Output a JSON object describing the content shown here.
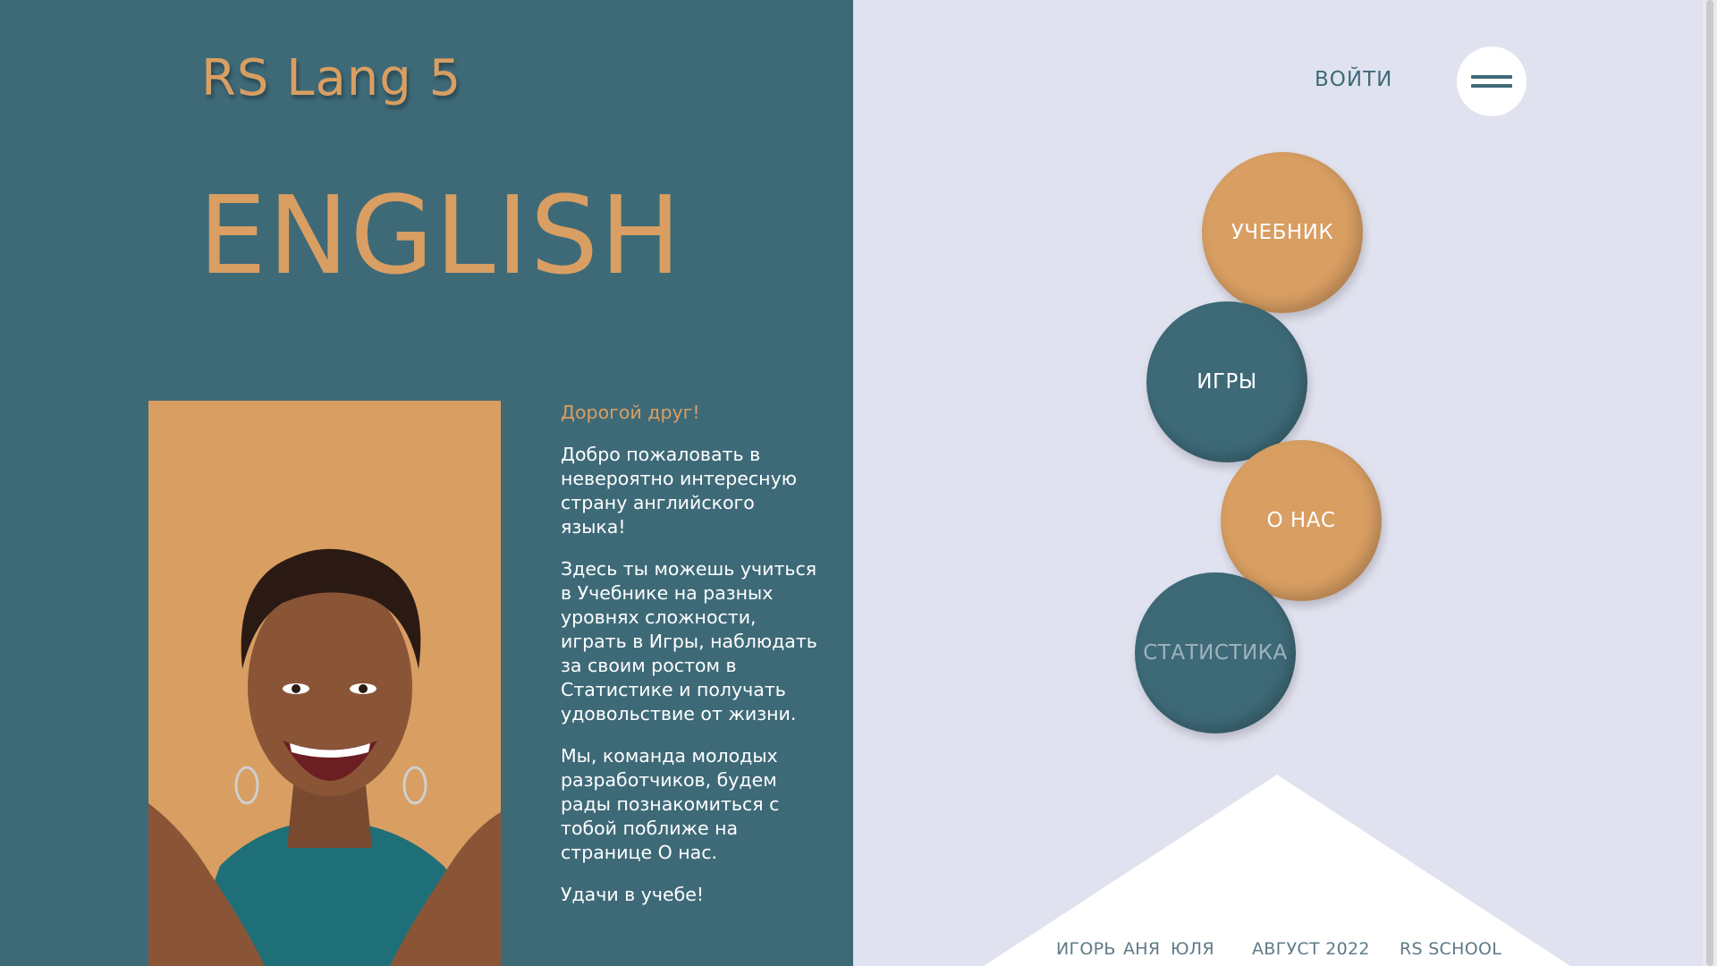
{
  "header": {
    "logo": "RS Lang 5",
    "login_label": "ВОЙТИ",
    "menu_icon": "hamburger-icon"
  },
  "hero": {
    "title": "ENGLISH",
    "photo_alt_icon": "smiling-woman-photo"
  },
  "welcome": {
    "greeting": "Дорогой друг!",
    "paragraphs": [
      "Добро пожаловать в невероятно интересную страну английского языка!",
      "Здесь ты можешь учиться в Учебнике на разных уровнях сложности, играть в Игры, наблюдать за своим ростом в Статистике и получать удовольствие от жизни.",
      "Мы, команда молодых разработчиков, будем рады познакомиться с тобой поближе на странице О нас.",
      "Удачи в учебе!"
    ]
  },
  "nav": {
    "textbook": "УЧЕБНИК",
    "games": "ИГРЫ",
    "about": "О НАС",
    "statistics": "СТАТИСТИКА"
  },
  "footer": {
    "authors": [
      "ИГОРЬ",
      "АНЯ",
      "ЮЛЯ"
    ],
    "date": "АВГУСТ 2022",
    "school": "RS SCHOOL"
  },
  "colors": {
    "teal": "#3e6a78",
    "orange": "#d89e62",
    "background": "#e1e2ef",
    "white": "#ffffff"
  }
}
